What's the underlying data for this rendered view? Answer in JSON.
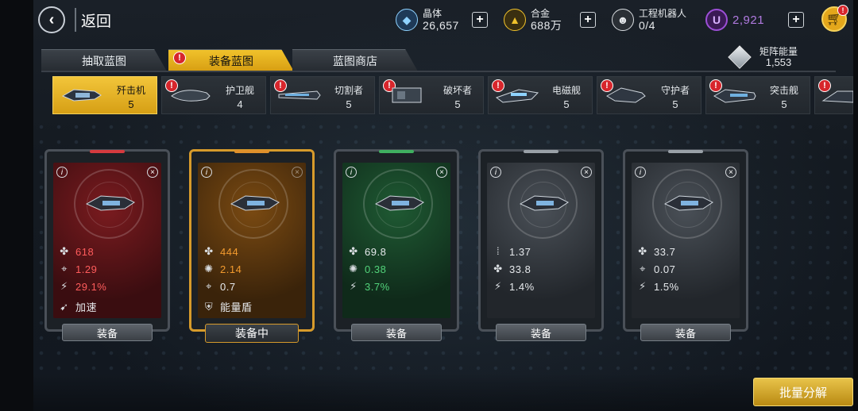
{
  "back": {
    "label": "返回"
  },
  "resources": {
    "crystal": {
      "name": "晶体",
      "value": "26,657"
    },
    "alloy": {
      "name": "合金",
      "value": "688万"
    },
    "robots": {
      "name": "工程机器人",
      "value": "0/4"
    },
    "u_currency": {
      "icon_letter": "U",
      "value": "2,921"
    }
  },
  "tabs": [
    {
      "label": "抽取蓝图"
    },
    {
      "label": "装备蓝图"
    },
    {
      "label": "蓝图商店"
    }
  ],
  "matrix": {
    "label": "矩阵能量",
    "value": "1,553"
  },
  "ships": [
    {
      "name": "歼击机",
      "count": "5"
    },
    {
      "name": "护卫舰",
      "count": "4"
    },
    {
      "name": "切割者",
      "count": "5"
    },
    {
      "name": "破坏者",
      "count": "5"
    },
    {
      "name": "电磁舰",
      "count": "5"
    },
    {
      "name": "守护者",
      "count": "5"
    },
    {
      "name": "突击舰",
      "count": "5"
    }
  ],
  "cards": [
    {
      "rarity_color": "#c8363a",
      "stats": [
        "618",
        "1.29",
        "29.1%"
      ],
      "skill": "加速",
      "button": "装备"
    },
    {
      "rarity_color": "#e0902b",
      "stats": [
        "444",
        "2.14",
        "0.7"
      ],
      "skill": "能量盾",
      "button": "装备中"
    },
    {
      "rarity_color": "#3fb060",
      "stats": [
        "69.8",
        "0.38",
        "3.7%"
      ],
      "button": "装备"
    },
    {
      "rarity_color": "#9aa1a8",
      "stats": [
        "1.37",
        "33.8",
        "1.4%"
      ],
      "button": "装备"
    },
    {
      "rarity_color": "#9aa1a8",
      "stats": [
        "33.7",
        "0.07",
        "1.5%"
      ],
      "button": "装备"
    }
  ],
  "bulk_button": "批量分解",
  "colors": {
    "accent": "#f0c22b",
    "alert": "#d7262c",
    "u_purple": "#9c4fd6"
  }
}
